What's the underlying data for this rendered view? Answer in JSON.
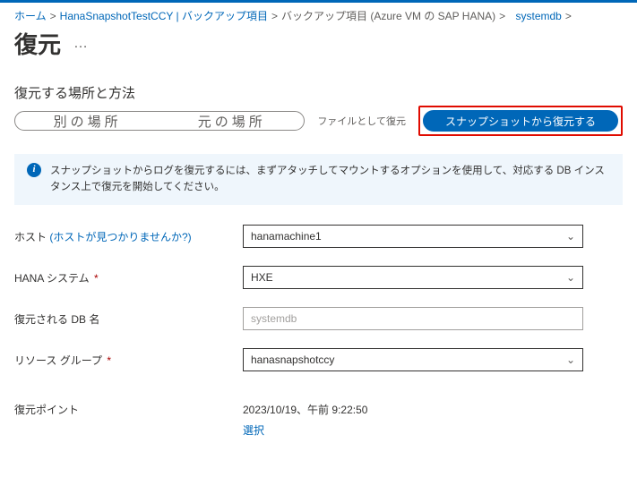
{
  "breadcrumb": {
    "home": "ホーム",
    "item1": "HanaSnapshotTestCCY | バックアップ項目",
    "item2": "バックアップ項目 (Azure VM の SAP HANA)",
    "item3": "systemdb"
  },
  "page": {
    "title": "復元",
    "more": "…"
  },
  "section": {
    "heading": "復元する場所と方法"
  },
  "tabs": {
    "alt_location": "別の場所",
    "orig_location": "元の場所",
    "restore_as_files": "ファイルとして復元",
    "restore_from_snapshot": "スナップショットから復元する"
  },
  "info": {
    "text": "スナップショットからログを復元するには、まずアタッチしてマウントするオプションを使用して、対応する DB インスタンス上で復元を開始してください。"
  },
  "form": {
    "host_label": "ホスト",
    "host_hint": " (ホストが見つかりませんか?)",
    "host_value": "hanamachine1",
    "hana_system_label": "HANA システム",
    "hana_system_value": "HXE",
    "restored_db_label": "復元される DB 名",
    "restored_db_value": "systemdb",
    "resource_group_label": "リソース グループ ",
    "resource_group_value": "hanasnapshotccy",
    "restore_point_label": "復元ポイント",
    "restore_point_value": "2023/10/19、午前 9:22:50",
    "restore_point_select": "選択",
    "required": "*"
  }
}
